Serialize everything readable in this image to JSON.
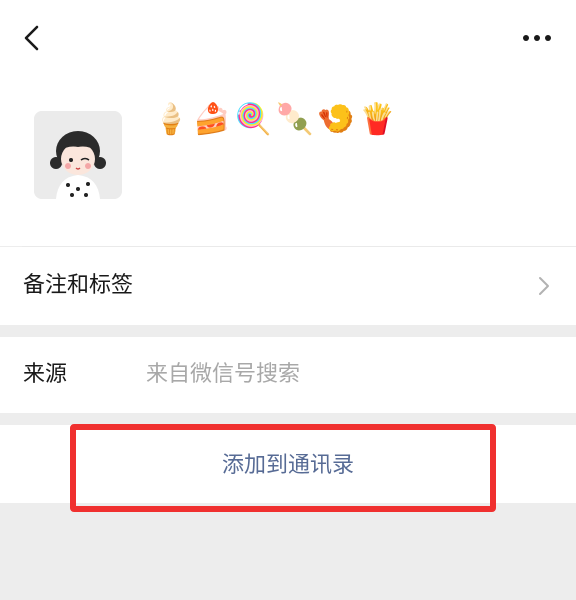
{
  "header": {
    "back_icon": "chevron-left-icon",
    "more_icon": "ellipsis-icon"
  },
  "profile": {
    "avatar_icon": "cartoon-girl-avatar",
    "nickname": "🍦🍰🍭🍡🍤🍟"
  },
  "remark_row": {
    "label": "备注和标签",
    "chevron_icon": "chevron-right-icon"
  },
  "source_row": {
    "label": "来源",
    "value": "来自微信号搜索"
  },
  "actions": {
    "add_to_contacts": "添加到通讯录"
  },
  "colors": {
    "background": "#ededed",
    "surface": "#ffffff",
    "link_blue": "#576b95",
    "secondary_text": "#a8a8a8",
    "highlight_red": "#f0302f"
  }
}
